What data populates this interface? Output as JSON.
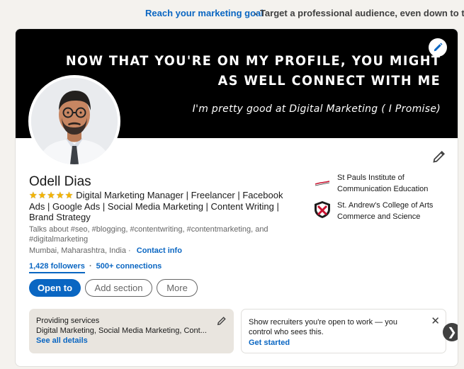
{
  "ad": {
    "link": "Reach your marketing goal",
    "rest": "- Target a professional audience, even down to the j"
  },
  "banner": {
    "line1": "NOW THAT YOU'RE ON MY PROFILE, YOU MIGHT",
    "line2": "AS WELL CONNECT WITH ME",
    "line3": "I'm pretty good at Digital Marketing ( I Promise)"
  },
  "profile": {
    "name": "Odell Dias",
    "stars": "★★★★★",
    "headline": "Digital Marketing Manager | Freelancer | Facebook Ads | Google Ads | Social Media Marketing | Content Writing | Brand Strategy",
    "talks_about": "Talks about #seo, #blogging, #contentwriting, #contentmarketing, and #digitalmarketing",
    "location": "Mumbai, Maharashtra, India",
    "location_sep": "·",
    "contact_info": "Contact info",
    "followers": "1,428 followers",
    "network_sep": "·",
    "connections": "500+ connections"
  },
  "education": [
    {
      "name": "St Pauls Institute of Communication Education"
    },
    {
      "name": "St. Andrew's College of Arts Commerce and Science"
    }
  ],
  "buttons": {
    "open_to": "Open to",
    "add_section": "Add section",
    "more": "More"
  },
  "services_card": {
    "title": "Providing services",
    "desc": "Digital Marketing, Social Media Marketing, Cont...",
    "link": "See all details"
  },
  "open_to_work_card": {
    "title": "Show recruiters you're open to work — you control who sees this.",
    "link": "Get started",
    "close": "✕"
  },
  "carousel": {
    "next": "❯"
  },
  "colors": {
    "accent": "#0a66c2",
    "star": "#f5b400",
    "banner": "#000000"
  }
}
